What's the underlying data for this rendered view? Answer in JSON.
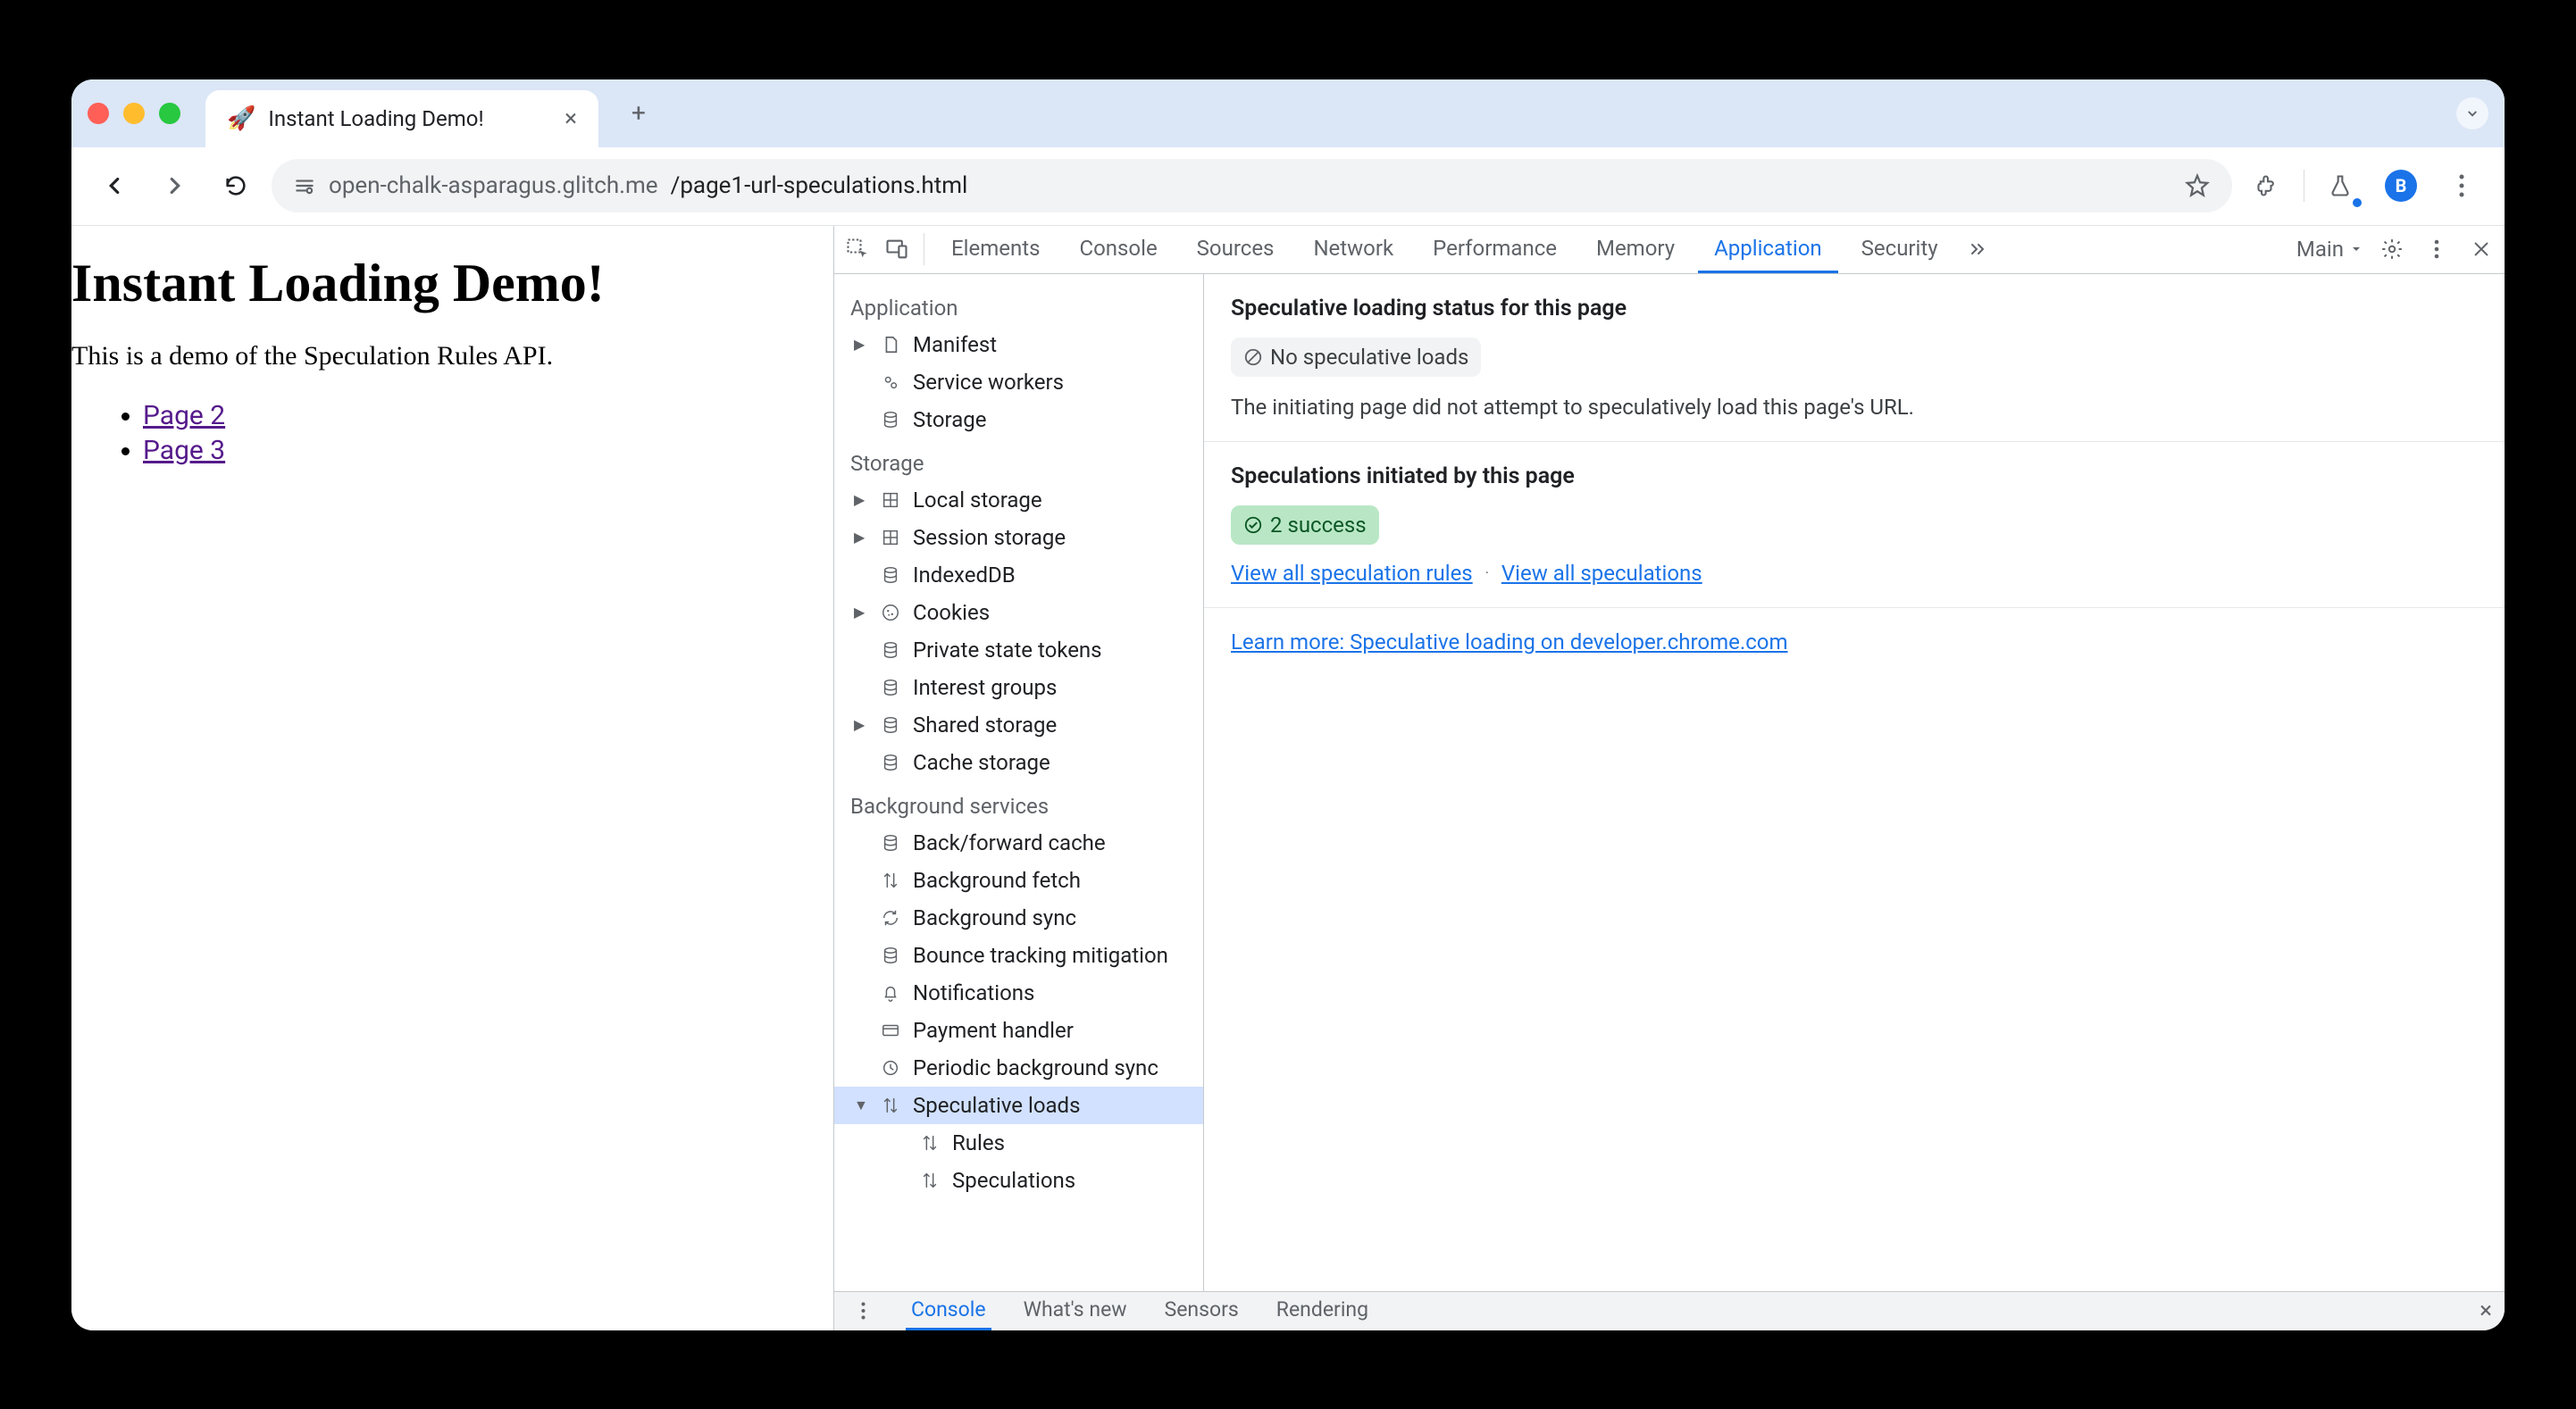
{
  "browserTab": {
    "favicon": "🚀",
    "title": "Instant Loading Demo!"
  },
  "toolbar": {
    "url_host": "open-chalk-asparagus.glitch.me",
    "url_path": "/page1-url-speculations.html",
    "avatar_letter": "B"
  },
  "page": {
    "heading": "Instant Loading Demo!",
    "intro": "This is a demo of the Speculation Rules API.",
    "links": [
      "Page 2",
      "Page 3"
    ]
  },
  "devtools": {
    "tabs": [
      "Elements",
      "Console",
      "Sources",
      "Network",
      "Performance",
      "Memory",
      "Application",
      "Security"
    ],
    "active_tab": "Application",
    "frame_label": "Main",
    "sidebar": {
      "sections": [
        {
          "title": "Application",
          "items": [
            {
              "label": "Manifest",
              "icon": "file",
              "expandable": true
            },
            {
              "label": "Service workers",
              "icon": "gears"
            },
            {
              "label": "Storage",
              "icon": "db"
            }
          ]
        },
        {
          "title": "Storage",
          "items": [
            {
              "label": "Local storage",
              "icon": "grid",
              "expandable": true
            },
            {
              "label": "Session storage",
              "icon": "grid",
              "expandable": true
            },
            {
              "label": "IndexedDB",
              "icon": "db"
            },
            {
              "label": "Cookies",
              "icon": "cookie",
              "expandable": true
            },
            {
              "label": "Private state tokens",
              "icon": "db"
            },
            {
              "label": "Interest groups",
              "icon": "db"
            },
            {
              "label": "Shared storage",
              "icon": "db",
              "expandable": true
            },
            {
              "label": "Cache storage",
              "icon": "db"
            }
          ]
        },
        {
          "title": "Background services",
          "items": [
            {
              "label": "Back/forward cache",
              "icon": "db"
            },
            {
              "label": "Background fetch",
              "icon": "arrows"
            },
            {
              "label": "Background sync",
              "icon": "sync"
            },
            {
              "label": "Bounce tracking mitigation",
              "icon": "db"
            },
            {
              "label": "Notifications",
              "icon": "bell"
            },
            {
              "label": "Payment handler",
              "icon": "card"
            },
            {
              "label": "Periodic background sync",
              "icon": "clock"
            },
            {
              "label": "Speculative loads",
              "icon": "arrows",
              "expandable": true,
              "selected": true,
              "open": true
            },
            {
              "label": "Rules",
              "icon": "arrows",
              "indent": true
            },
            {
              "label": "Speculations",
              "icon": "arrows",
              "indent": true
            }
          ]
        }
      ]
    },
    "main": {
      "status_heading": "Speculative loading status for this page",
      "status_badge": "No speculative loads",
      "status_text": "The initiating page did not attempt to speculatively load this page's URL.",
      "initiated_heading": "Speculations initiated by this page",
      "initiated_badge": "2 success",
      "link_rules": "View all speculation rules",
      "link_specs": "View all speculations",
      "learn_more": "Learn more: Speculative loading on developer.chrome.com"
    },
    "drawer": {
      "tabs": [
        "Console",
        "What's new",
        "Sensors",
        "Rendering"
      ],
      "active": "Console"
    }
  }
}
